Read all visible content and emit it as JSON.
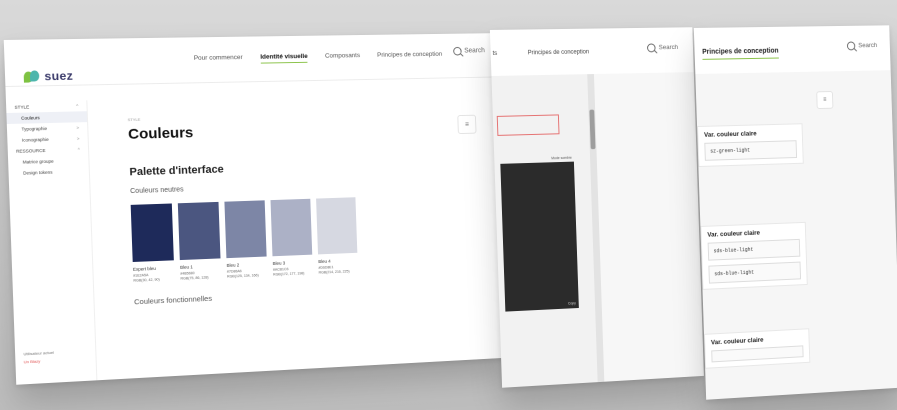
{
  "main": {
    "logo_text": "suez",
    "nav": [
      "Pour commencer",
      "Identité visuelle",
      "Composants",
      "Principes de conception"
    ],
    "search_label": "Search",
    "sidebar": {
      "items": [
        {
          "label": "STYLE",
          "sub": false,
          "selected": false,
          "chev": "^"
        },
        {
          "label": "Couleurs",
          "sub": true,
          "selected": true,
          "chev": ""
        },
        {
          "label": "Typographie",
          "sub": true,
          "selected": false,
          "chev": ">"
        },
        {
          "label": "Iconographie",
          "sub": true,
          "selected": false,
          "chev": ">"
        },
        {
          "label": "RESSOURCE",
          "sub": false,
          "selected": false,
          "chev": "^"
        },
        {
          "label": "Matrice groupe",
          "sub": true,
          "selected": false,
          "chev": ""
        },
        {
          "label": "Design tokens",
          "sub": true,
          "selected": false,
          "chev": ""
        }
      ],
      "footer_text": "Utilisateur actuel",
      "footer_badge": "Un Blazy"
    },
    "breadcrumb": "STYLE",
    "page_title": "Couleurs",
    "section_title": "Palette d'interface",
    "subsection_title": "Couleurs neutres",
    "swatches": [
      {
        "name": "Expert bleu",
        "hex": "#1E2A5A",
        "code1": "#1E2A5A",
        "code2": "RGB(30, 42, 90)"
      },
      {
        "name": "Bleu 1",
        "hex": "#4B5680",
        "code1": "#4B5680",
        "code2": "RGB(75, 86, 128)"
      },
      {
        "name": "Bleu 2",
        "hex": "#7D86A6",
        "code1": "#7D86A6",
        "code2": "RGB(125, 134, 166)"
      },
      {
        "name": "Bleu 3",
        "hex": "#ACB1C6",
        "code1": "#ACB1C6",
        "code2": "RGB(172, 177, 198)"
      },
      {
        "name": "Bleu 4",
        "hex": "#D6D8E1",
        "code1": "#D6D8E1",
        "code2": "RGB(214, 216, 225)"
      }
    ],
    "next_section_title": "Couleurs fonctionnelles",
    "toc_icon": "toc-icon"
  },
  "middle": {
    "tab_prefix": "ts",
    "tab_label": "Principes de conception",
    "search_label": "Search",
    "dark_tag": "Mode sombre",
    "dark_copy": "Copy"
  },
  "right": {
    "title": "Principes de conception",
    "search_label": "Search",
    "cards": [
      {
        "title": "Var. couleur claire",
        "codes": [
          "sz-green-light"
        ]
      },
      {
        "title": "Var. couleur claire",
        "codes": [
          "sds-blue-light",
          "sds-blue-light"
        ]
      },
      {
        "title": "Var. couleur claire",
        "codes": [
          ""
        ]
      }
    ]
  },
  "accent_green": "#8BC34A"
}
